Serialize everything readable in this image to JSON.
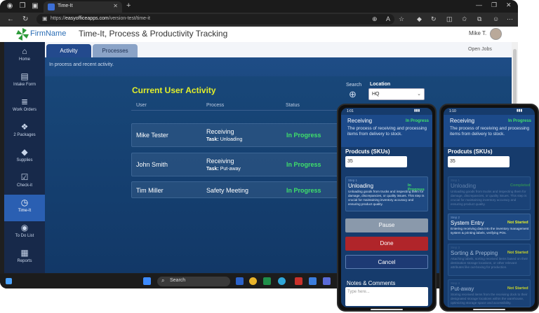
{
  "browser": {
    "tab_title": "Time-It",
    "url_prefix": "https://",
    "url_host": "easyofficeapps.com",
    "url_path": "/version-test/time-it",
    "new_tab_icon": "plus-icon"
  },
  "app": {
    "brand": "FirmName",
    "title": "Time-It, Process & Productivity Tracking",
    "user": "Mike T."
  },
  "sidebar": {
    "items": [
      {
        "label": "Home",
        "icon": "home-icon",
        "glyph": "⌂"
      },
      {
        "label": "Intake Form",
        "icon": "document-icon",
        "glyph": "▤"
      },
      {
        "label": "Work Orders",
        "icon": "list-icon",
        "glyph": "≣"
      },
      {
        "label": "2 Packages",
        "icon": "boxes-icon",
        "glyph": "❖"
      },
      {
        "label": "Supplies",
        "icon": "tag-icon",
        "glyph": "◆"
      },
      {
        "label": "Check-it",
        "icon": "checkbox-icon",
        "glyph": "☑"
      },
      {
        "label": "Time-It",
        "icon": "clock-icon",
        "glyph": "◷",
        "active": true
      },
      {
        "label": "To Do List",
        "icon": "target-icon",
        "glyph": "◉"
      },
      {
        "label": "Reports",
        "icon": "report-icon",
        "glyph": "▦"
      }
    ]
  },
  "tabs": {
    "activity": "Activity",
    "processes": "Processes",
    "open_jobs": "Open Jobs"
  },
  "activity": {
    "subtitle": "In process and recent activity.",
    "title": "Current User Activity",
    "search_label": "Search",
    "location_label": "Location",
    "location_value": "HQ",
    "columns": {
      "user": "User",
      "process": "Process",
      "status": "Status"
    },
    "task_prefix": "Task:",
    "rows": [
      {
        "user": "Mike Tester",
        "process": "Receiving",
        "task": "Unloading",
        "status": "In Progress"
      },
      {
        "user": "John Smith",
        "process": "Receiving",
        "task": "Put-away",
        "status": "In Progress"
      },
      {
        "user": "Tim Miller",
        "process": "Safety Meeting",
        "task": "",
        "status": "In Progress"
      }
    ]
  },
  "taskbar": {
    "search": "Search"
  },
  "phone1": {
    "time": "1:01",
    "process": "Receiving",
    "badge": "In Progress",
    "description": "The process of receiving and processing items from delivery to stock.",
    "products_label": "Prodcuts (SKUs)",
    "products_value": "35",
    "step": {
      "number": "Step 1",
      "title": "Unloading",
      "status": "In Progress",
      "description": "Unloading goods from trucks and inspecting them for damage, discrepancies, or quality issues. This step is crucial for maintaining inventory accuracy and ensuring product quality."
    },
    "pause": "Pause",
    "done": "Done",
    "cancel": "Cancel",
    "notes_label": "Notes & Comments",
    "notes_placeholder": "Type here..."
  },
  "phone2": {
    "time": "1:10",
    "process": "Receiving",
    "badge": "In Progress",
    "description": "The process of receiving and processing items from delivery to stock.",
    "products_label": "Prodcuts (SKUs)",
    "products_value": "35",
    "steps": [
      {
        "number": "Step 1",
        "title": "Unloading",
        "status": "Completed",
        "description": "Unloading goods from trucks and inspecting them for damage, discrepancies, or quality issues. This step is crucial for maintaining inventory accuracy and ensuring product quality."
      },
      {
        "number": "Step 2",
        "title": "System Entry",
        "status": "Not Started",
        "description": "Entering receiving data into the inventory management system & printing labels, verifying POs."
      },
      {
        "number": "Step 3",
        "title": "Sorting & Prepping",
        "status": "Not Started",
        "description": "Attaching labels, sorting received items based on their destination storage locations, or other relevant attributes like out-boxing for production."
      },
      {
        "number": "Step 4",
        "title": "Put-away",
        "status": "Not Started",
        "description": "Storing received items from the receiving dock to their designated storage locations within the warehouse, optimizing storage space and accessibility."
      }
    ]
  },
  "colors": {
    "sidebar": "#17294a",
    "active": "#2a5fb2",
    "in_progress": "#3fe06a",
    "not_started": "#e3ef2a",
    "title_yellow": "#e3ef2a",
    "done_red": "#b0252a",
    "cancel_navy": "#1d3a74"
  }
}
